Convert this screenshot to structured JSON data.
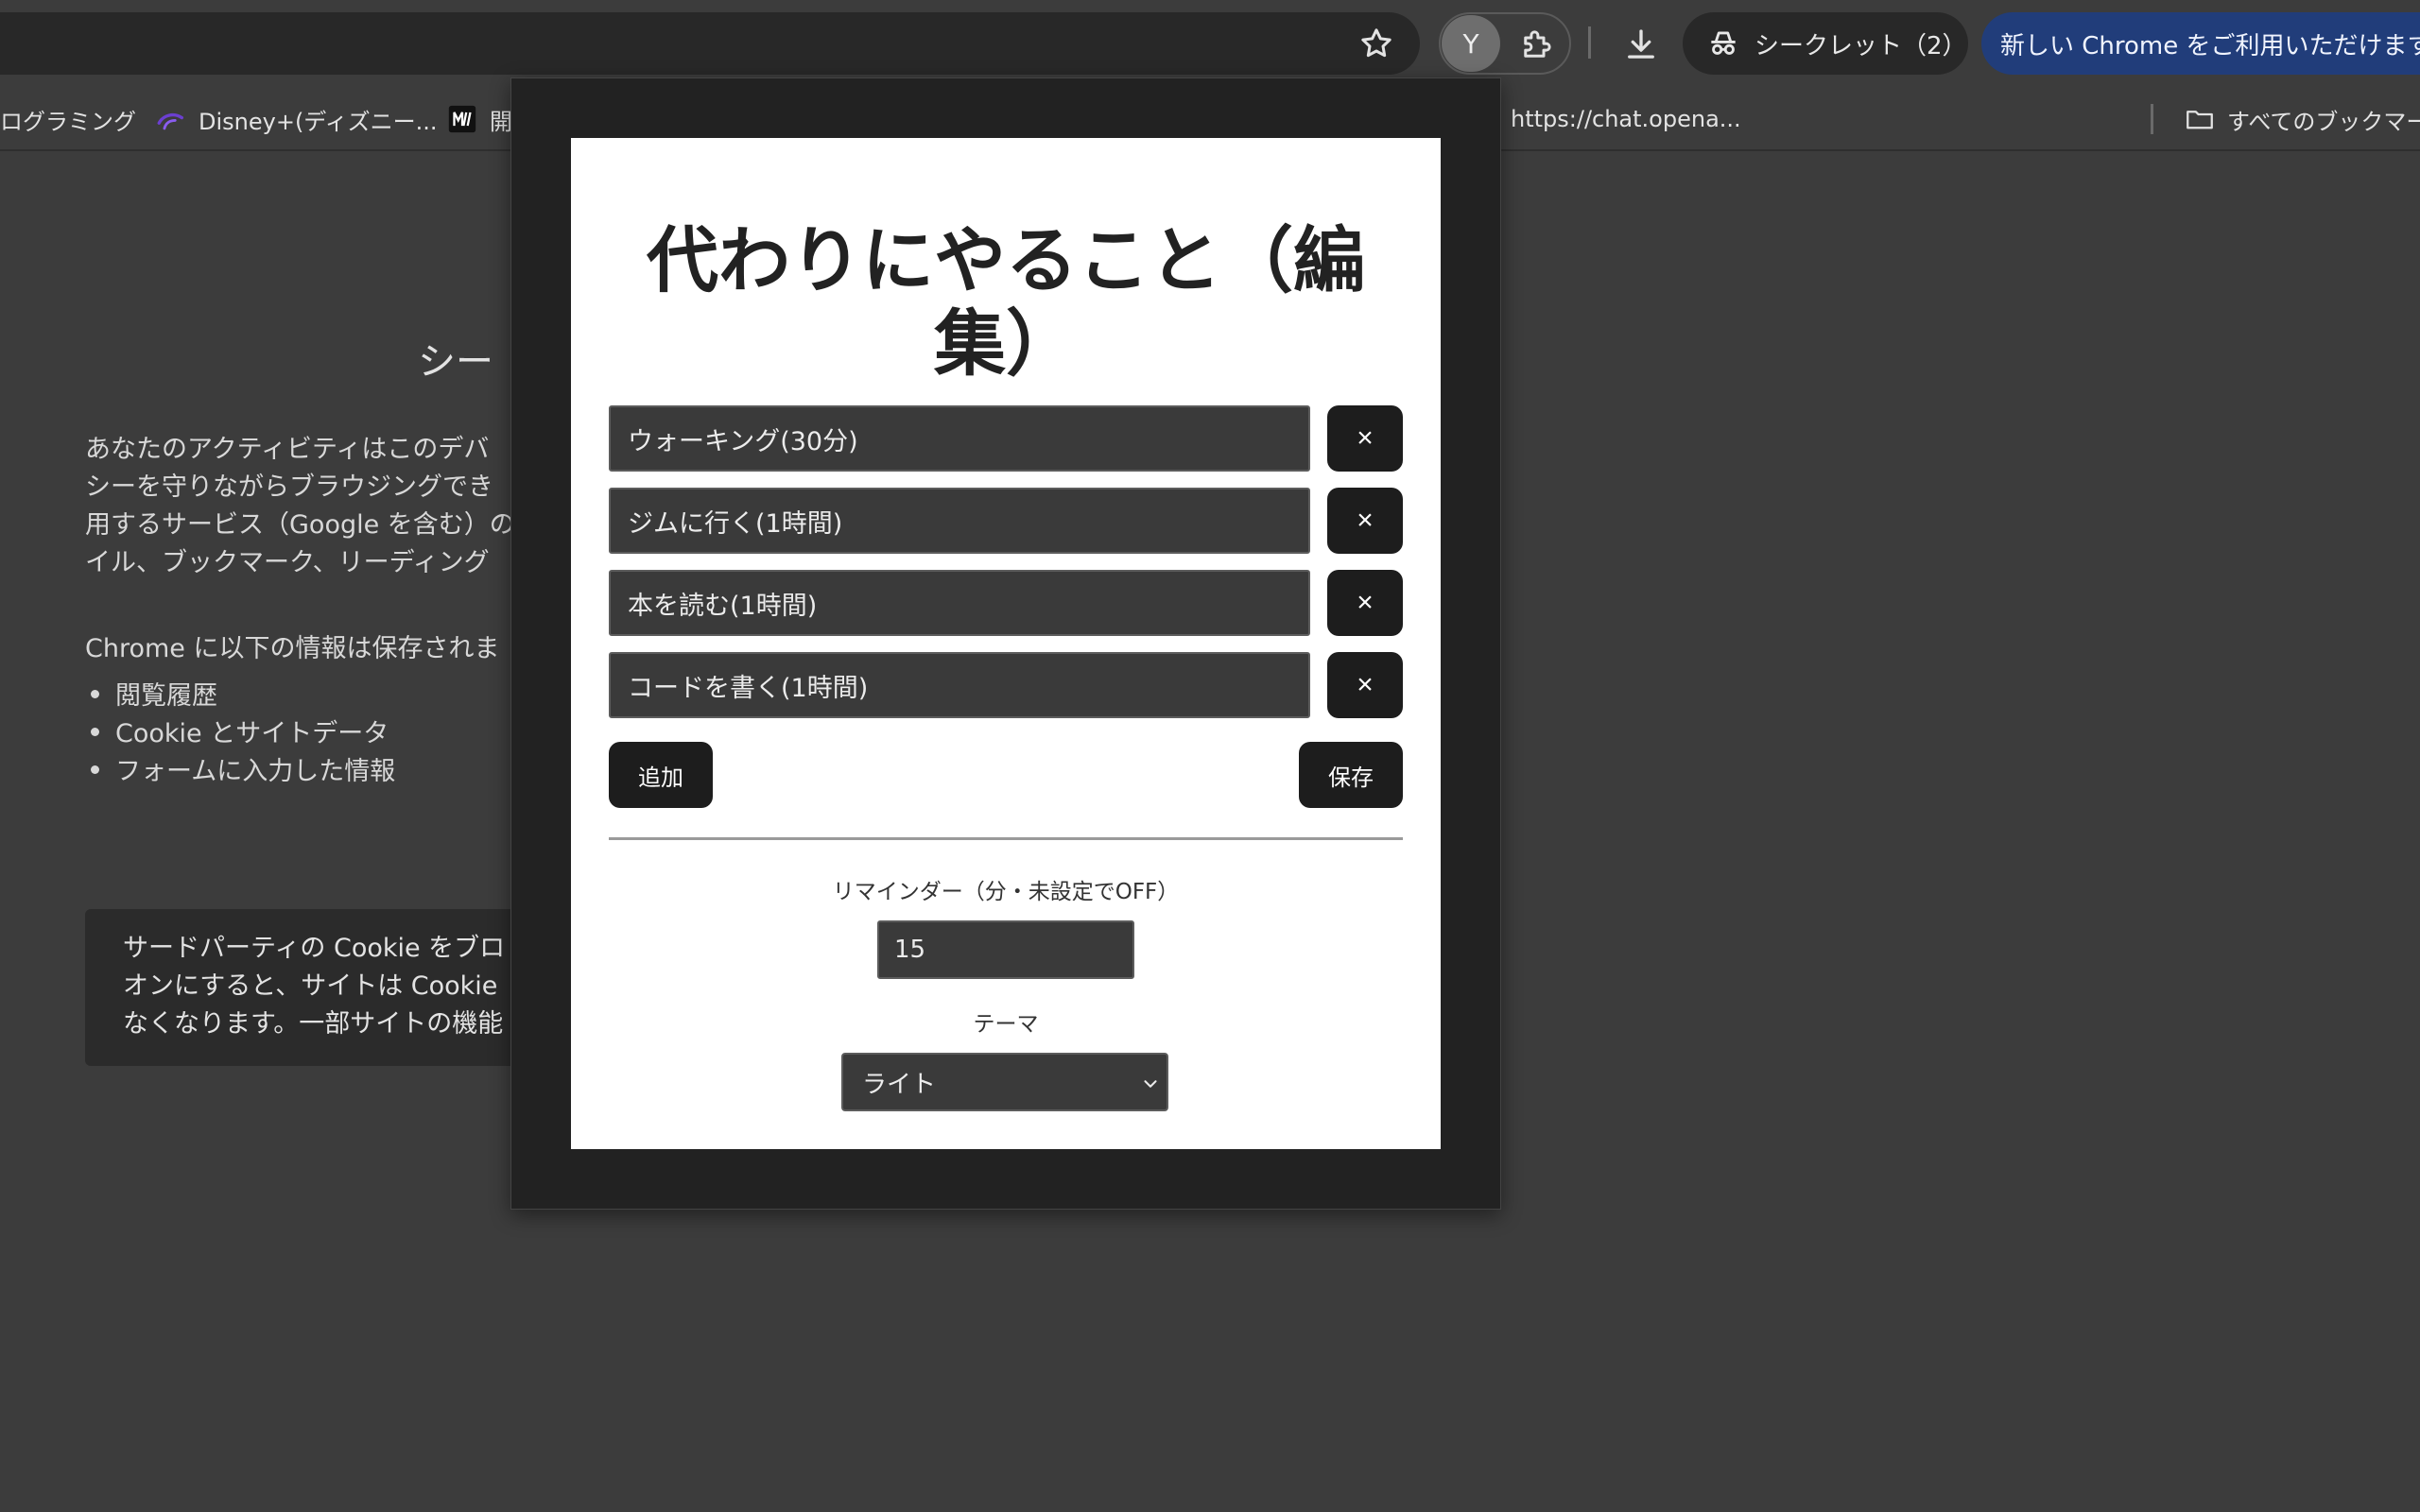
{
  "toolbar": {
    "avatar_letter": "Y",
    "incognito_label": "シークレット（2）",
    "update_label": "新しい Chrome をご利用いただけます"
  },
  "bookmarks": {
    "items": [
      {
        "label": "ログラミング"
      },
      {
        "label": "Disney+(ディズニー..."
      },
      {
        "label": "開"
      },
      {
        "label": "https://chat.opena..."
      }
    ],
    "all_bookmarks_label": "すべてのブックマーク"
  },
  "background_page": {
    "title": "シー",
    "paragraph_lines": [
      "あなたのアクティビティはこのデバ",
      "シーを守りながらブラウジングでき",
      "用するサービス（Google を含む）の",
      "イル、ブックマーク、リーディング"
    ],
    "not_saved_heading": "Chrome に以下の情報は保存されま",
    "not_saved_items": [
      "閲覧履歴",
      "Cookie とサイトデータ",
      "フォームに入力した情報"
    ],
    "cookie_card_lines": [
      "サードパーティの Cookie をブロ",
      "オンにすると、サイトは Cookie",
      "なくなります。一部サイトの機能"
    ]
  },
  "popup": {
    "title": "代わりにやること（編集）",
    "tasks": [
      {
        "value": "ウォーキング(30分)"
      },
      {
        "value": "ジムに行く(1時間)"
      },
      {
        "value": "本を読む(1時間)"
      },
      {
        "value": "コードを書く(1時間)"
      }
    ],
    "remove_symbol": "×",
    "add_label": "追加",
    "save_label": "保存",
    "reminder_label": "リマインダー（分・未設定でOFF）",
    "reminder_value": "15",
    "theme_label": "テーマ",
    "theme_value": "ライト"
  }
}
